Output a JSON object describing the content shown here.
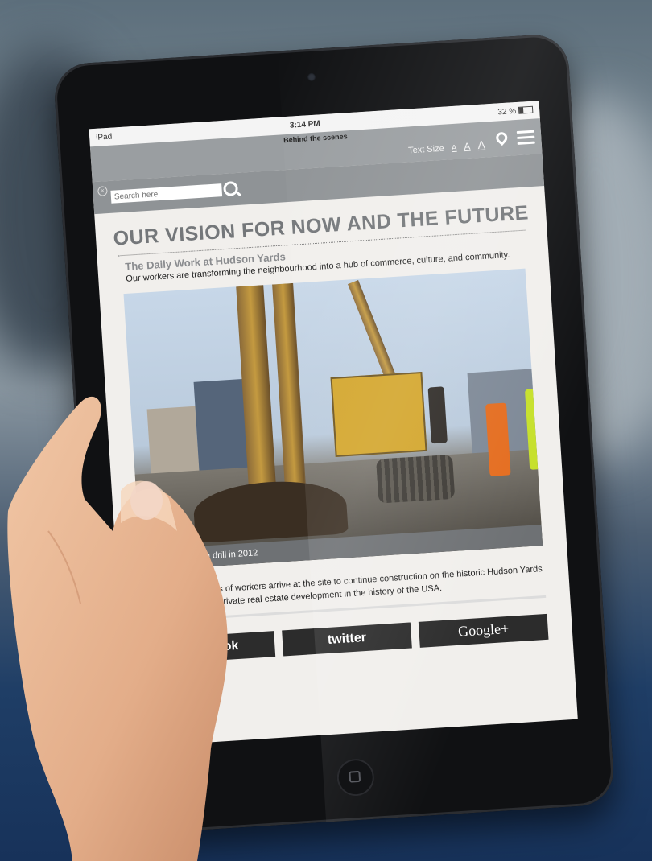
{
  "status_bar": {
    "device": "iPad",
    "time": "3:14 PM",
    "battery": "32 %",
    "battery_level": 0.32
  },
  "header": {
    "title": "Behind the scenes",
    "text_size_label": "Text Size",
    "text_size_options": [
      "A",
      "A",
      "A"
    ]
  },
  "search": {
    "placeholder": "Search here"
  },
  "article": {
    "headline": "OUR VISION FOR NOW AND THE FUTURE",
    "subtitle": "The Daily Work at Hudson Yards",
    "description": "Our workers are transforming the neighbourhood into a hub of commerce, culture, and community.",
    "photo_caption": "Groundbreaking drill in 2012",
    "body": "Every day, hundreds of workers arrive at the site to continue construction on the historic Hudson Yards project, the largest private real estate development in the history of the USA."
  },
  "social": {
    "facebook": "facebook",
    "twitter": "twitter",
    "google": "Google+"
  }
}
